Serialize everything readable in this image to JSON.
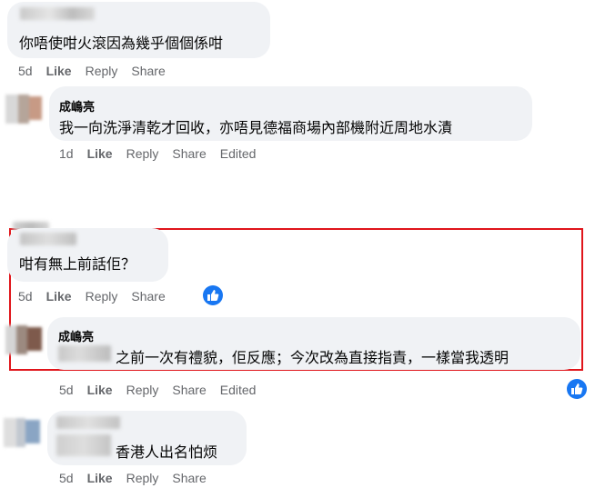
{
  "comments": [
    {
      "text": "你唔使咁火滾因為幾乎個個係咁",
      "time": "5d",
      "like": "Like",
      "reply": "Reply",
      "share": "Share"
    },
    {
      "author": "成嶋亮",
      "text": "我一向洗淨清乾才回收，亦唔見德福商場內部機附近周地水漬",
      "time": "1d",
      "like": "Like",
      "reply": "Reply",
      "share": "Share",
      "edited": "Edited"
    },
    {
      "text": "咁有無上前話佢？",
      "time": "5d",
      "like": "Like",
      "reply": "Reply",
      "share": "Share"
    },
    {
      "author": "成嶋亮",
      "text": "之前一次有禮貌，佢反應；今次改為直接指責，一樣當我透明",
      "time": "5d",
      "like": "Like",
      "reply": "Reply",
      "share": "Share",
      "edited": "Edited"
    },
    {
      "text": "香港人出名怕烦",
      "time": "5d",
      "like": "Like",
      "reply": "Reply",
      "share": "Share"
    }
  ],
  "colors": {
    "highlight": "#e0151b",
    "like_blue": "#1877f2",
    "bubble": "#f0f2f5",
    "meta": "#65676b"
  }
}
